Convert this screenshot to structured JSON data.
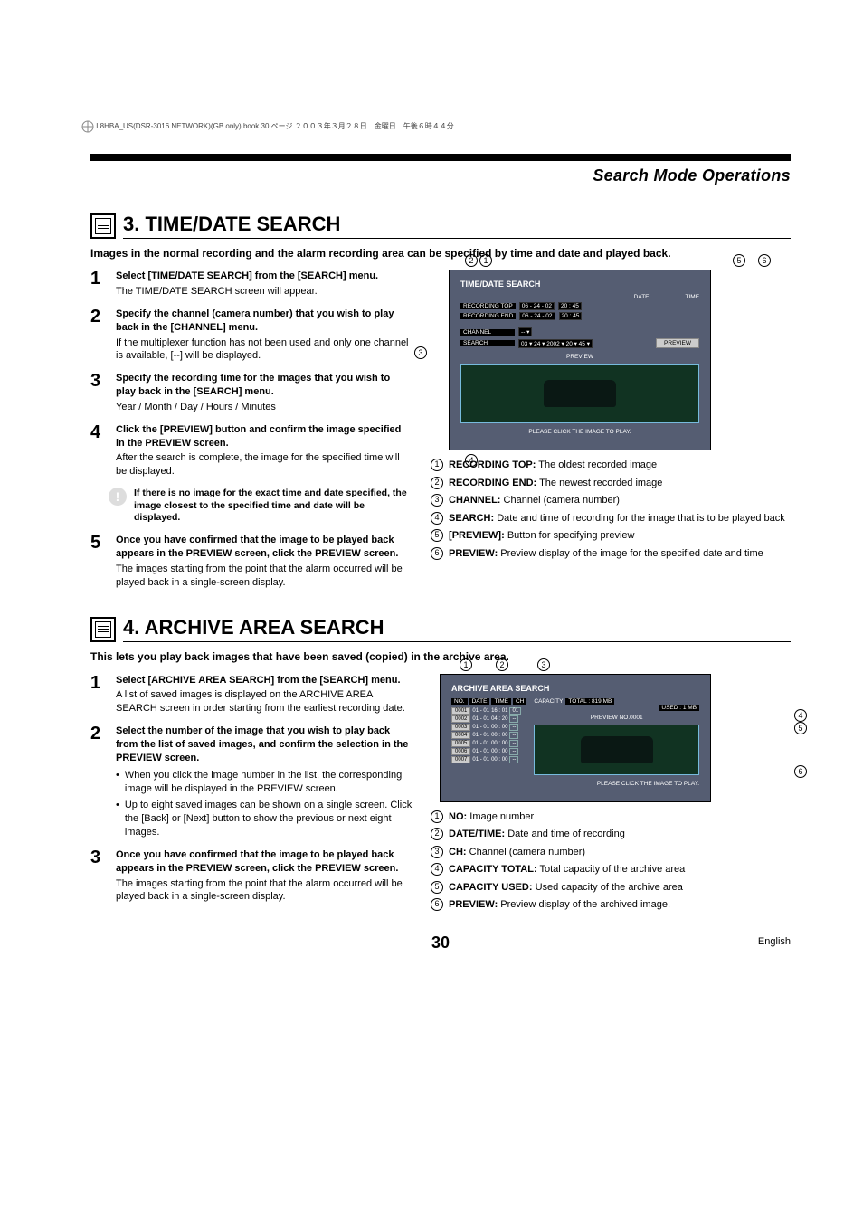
{
  "header_note": "L8HBA_US(DSR-3016 NETWORK)(GB only).book  30 ページ  ２００３年３月２８日　金曜日　午後６時４４分",
  "main_section": "Search Mode Operations",
  "page_number": "30",
  "page_lang": "English",
  "sec3": {
    "title": "3. TIME/DATE SEARCH",
    "intro": "Images in the normal recording and the alarm recording area can be specified by time and date and played back.",
    "steps": [
      {
        "num": "1",
        "head": "Select [TIME/DATE SEARCH] from the [SEARCH] menu.",
        "desc": "The TIME/DATE SEARCH screen will appear."
      },
      {
        "num": "2",
        "head": "Specify the channel (camera number) that you wish to play back in the [CHANNEL] menu.",
        "desc": "If the multiplexer function has not been used and only one channel is available, [--] will be displayed."
      },
      {
        "num": "3",
        "head": "Specify the recording time for the images that you wish to play back in the [SEARCH] menu.",
        "desc": "Year / Month / Day / Hours / Minutes"
      },
      {
        "num": "4",
        "head": "Click the [PREVIEW] button and confirm the image specified in the PREVIEW screen.",
        "desc": "After the search is complete, the image for the specified time will be displayed."
      },
      {
        "num": "5",
        "head": "Once you have confirmed that the image to be played back appears in the PREVIEW screen, click the PREVIEW screen.",
        "desc": "The images starting from the point that the alarm occurred will be played back in a single-screen display."
      }
    ],
    "note": "If there is no image for the exact time and date specified, the image closest to the specified time and date will be displayed.",
    "callouts": [
      {
        "n": "1",
        "label": "RECORDING TOP:",
        "text": "The oldest recorded image"
      },
      {
        "n": "2",
        "label": "RECORDING END:",
        "text": "The newest recorded image"
      },
      {
        "n": "3",
        "label": "CHANNEL:",
        "text": "Channel (camera number)"
      },
      {
        "n": "4",
        "label": "SEARCH:",
        "text": "Date and time of recording for the image that is to be played back"
      },
      {
        "n": "5",
        "label": "[PREVIEW]:",
        "text": "Button for specifying preview"
      },
      {
        "n": "6",
        "label": "PREVIEW:",
        "text": "Preview display of the image for the specified date and time"
      }
    ],
    "fig": {
      "title": "TIME/DATE SEARCH",
      "col_date": "DATE",
      "col_time": "TIME",
      "rec_top_label": "RECORDING TOP",
      "rec_top_date": "06  -  24  -  02",
      "rec_top_time": "20  :  45",
      "rec_end_label": "RECORDING END",
      "rec_end_date": "06  -  24  -  02",
      "rec_end_time": "20  :  45",
      "channel_label": "CHANNEL",
      "channel_val": "-- ▾",
      "search_label": "SEARCH",
      "search_vals": "03 ▾  24 ▾  2002 ▾    20 ▾  45 ▾",
      "preview_btn": "PREVIEW",
      "preview_label": "PREVIEW",
      "hint": "PLEASE CLICK THE IMAGE TO PLAY."
    }
  },
  "sec4": {
    "title": "4. ARCHIVE AREA SEARCH",
    "intro": "This lets you play back images that have been saved (copied) in the archive area.",
    "steps": [
      {
        "num": "1",
        "head": "Select [ARCHIVE AREA SEARCH] from the [SEARCH] menu.",
        "desc": "A list of saved images is displayed on the ARCHIVE AREA SEARCH screen in order starting from the earliest recording date."
      },
      {
        "num": "2",
        "head": "Select the number of the image that you wish to play back from the list of saved images, and confirm the selection in the PREVIEW screen.",
        "bullets": [
          "When you click the image number in the list, the corresponding image will be displayed in the PREVIEW screen.",
          "Up to eight saved images can be shown on a single screen. Click the [Back] or [Next] button to show the previous or next eight images."
        ]
      },
      {
        "num": "3",
        "head": "Once you have confirmed that the image to be played back appears in the PREVIEW screen, click the PREVIEW screen.",
        "desc": "The images starting from the point that the alarm occurred will be played back in a single-screen display."
      }
    ],
    "callouts": [
      {
        "n": "1",
        "label": "NO:",
        "text": "Image number"
      },
      {
        "n": "2",
        "label": "DATE/TIME:",
        "text": "Date and time of recording"
      },
      {
        "n": "3",
        "label": "CH:",
        "text": "Channel (camera number)"
      },
      {
        "n": "4",
        "label": "CAPACITY TOTAL:",
        "text": "Total capacity of the archive area"
      },
      {
        "n": "5",
        "label": "CAPACITY USED:",
        "text": "Used capacity of the archive area"
      },
      {
        "n": "6",
        "label": "PREVIEW:",
        "text": "Preview display of the archived image."
      }
    ],
    "fig": {
      "title": "ARCHIVE AREA SEARCH",
      "head_no": "NO.",
      "head_date": "DATE",
      "head_time": "TIME",
      "head_ch": "CH",
      "capacity_label": "CAPACITY",
      "total_label": "TOTAL :",
      "total_val": "819 MB",
      "used_label": "USED  :",
      "used_val": "1 MB",
      "preview_label": "PREVIEW NO.0001",
      "hint": "PLEASE CLICK THE IMAGE TO PLAY.",
      "rows": [
        {
          "no": "0001",
          "date": "01 - 01",
          "time": "16 : 01",
          "ch": "01"
        },
        {
          "no": "0002",
          "date": "01 - 01",
          "time": "04 : 20",
          "ch": "--"
        },
        {
          "no": "0003",
          "date": "01 - 01",
          "time": "00 : 00",
          "ch": "--"
        },
        {
          "no": "0004",
          "date": "01 - 01",
          "time": "00 : 00",
          "ch": "--"
        },
        {
          "no": "0005",
          "date": "01 - 01",
          "time": "00 : 00",
          "ch": "--"
        },
        {
          "no": "0006",
          "date": "01 - 01",
          "time": "00 : 00",
          "ch": "--"
        },
        {
          "no": "0007",
          "date": "01 - 01",
          "time": "00 : 00",
          "ch": "--"
        }
      ]
    }
  }
}
